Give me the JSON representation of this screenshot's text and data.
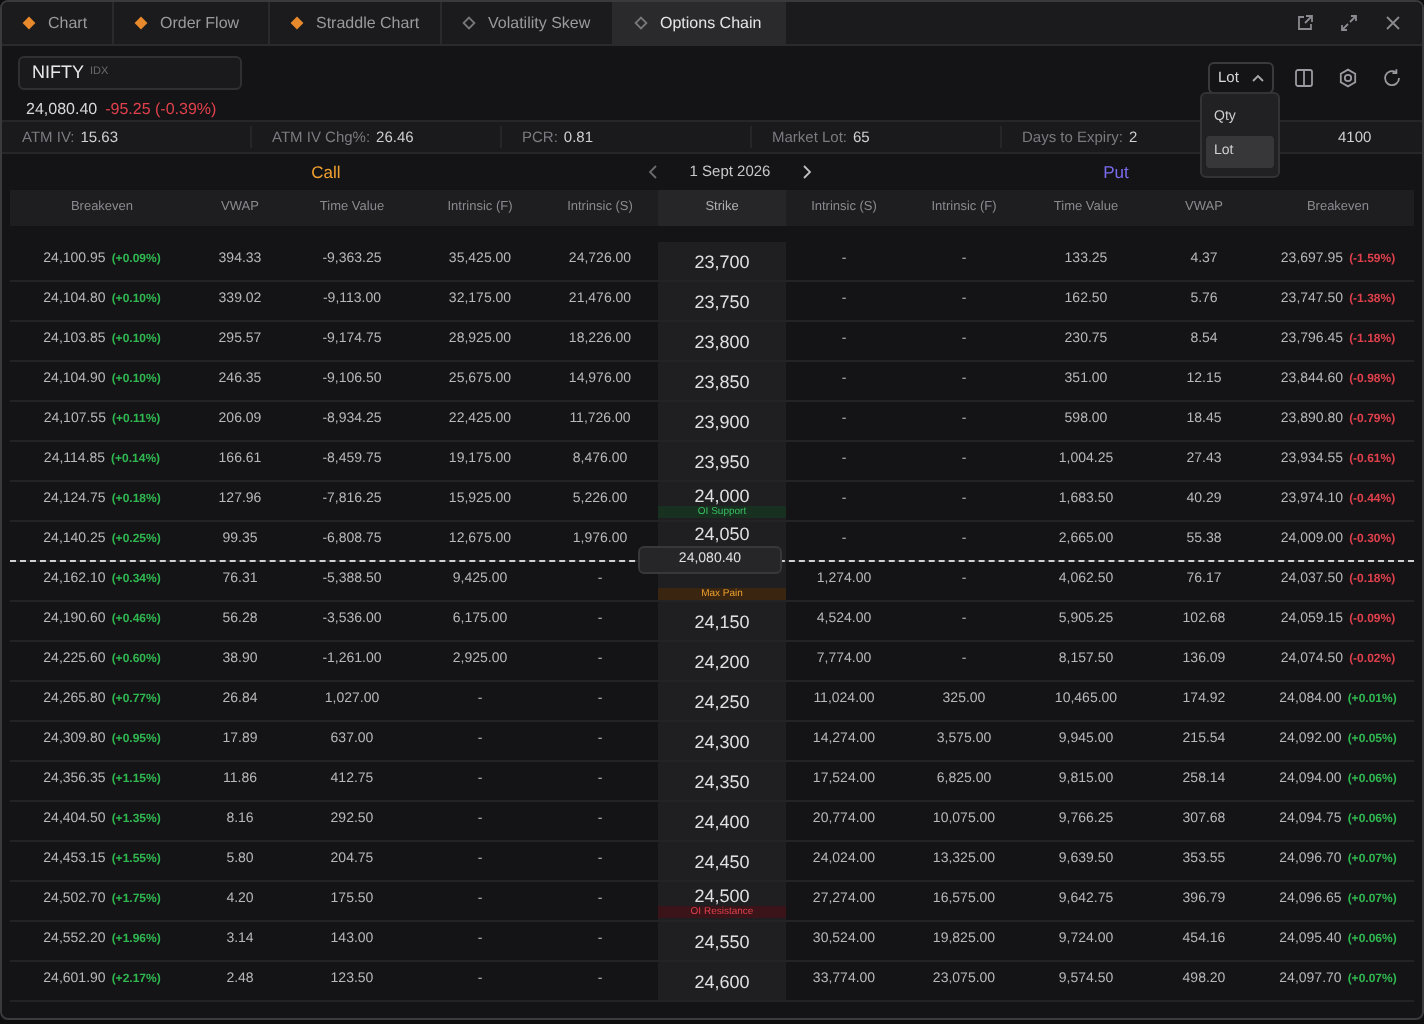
{
  "tabs": [
    {
      "label": "Chart",
      "kind": "filled",
      "selected": false
    },
    {
      "label": "Order Flow",
      "kind": "filled",
      "selected": false
    },
    {
      "label": "Straddle Chart",
      "kind": "filled",
      "selected": false
    },
    {
      "label": "Volatility Skew",
      "kind": "outline",
      "selected": false
    },
    {
      "label": "Options Chain",
      "kind": "outline",
      "selected": true
    }
  ],
  "symbol": {
    "name": "NIFTY",
    "exchange": "IDX",
    "price": "24,080.40",
    "change": "-95.25 (-0.39%)",
    "color": "#e0404c"
  },
  "unit_select": {
    "value": "Lot",
    "expanded": true,
    "options": [
      {
        "label": "Qty",
        "selected": false
      },
      {
        "label": "Lot",
        "selected": true
      }
    ]
  },
  "stats": [
    {
      "label": "ATM IV:",
      "value": "15.63"
    },
    {
      "label": "ATM IV Chg%:",
      "value": "26.46"
    },
    {
      "label": "PCR:",
      "value": "0.81"
    },
    {
      "label": "Market Lot:",
      "value": "65"
    },
    {
      "label": "Days to Expiry:",
      "value": "2"
    },
    {
      "value": "4100"
    }
  ],
  "chain_header": {
    "call_label": "Call",
    "expiry": "1 Sept 2026",
    "put_label": "Put"
  },
  "columns": [
    "Breakeven",
    "VWAP",
    "Time Value",
    "Intrinsic (F)",
    "Intrinsic (S)",
    "Strike",
    "Intrinsic (S)",
    "Intrinsic (F)",
    "Time Value",
    "VWAP",
    "Breakeven"
  ],
  "rows": [
    {
      "kind": "strike",
      "call": {
        "breakeven": "24,100.95",
        "change": "(+0.09%)",
        "color": "#30b850",
        "vwap": "394.33",
        "time_value": "-9,363.25",
        "intrinsic_f": "35,425.00",
        "intrinsic_s": "24,726.00"
      },
      "strike": "23,700",
      "put": {
        "intrinsic_s": "-",
        "intrinsic_f": "-",
        "time_value": "133.25",
        "vwap": "4.37",
        "breakeven": "23,697.95",
        "change": "(-1.59%)",
        "color": "#e0404c"
      }
    },
    {
      "kind": "strike",
      "call": {
        "breakeven": "24,104.80",
        "change": "(+0.10%)",
        "color": "#30b850",
        "vwap": "339.02",
        "time_value": "-9,113.00",
        "intrinsic_f": "32,175.00",
        "intrinsic_s": "21,476.00"
      },
      "strike": "23,750",
      "put": {
        "intrinsic_s": "-",
        "intrinsic_f": "-",
        "time_value": "162.50",
        "vwap": "5.76",
        "breakeven": "23,747.50",
        "change": "(-1.38%)",
        "color": "#e0404c"
      }
    },
    {
      "kind": "strike",
      "call": {
        "breakeven": "24,103.85",
        "change": "(+0.10%)",
        "color": "#30b850",
        "vwap": "295.57",
        "time_value": "-9,174.75",
        "intrinsic_f": "28,925.00",
        "intrinsic_s": "18,226.00"
      },
      "strike": "23,800",
      "put": {
        "intrinsic_s": "-",
        "intrinsic_f": "-",
        "time_value": "230.75",
        "vwap": "8.54",
        "breakeven": "23,796.45",
        "change": "(-1.18%)",
        "color": "#e0404c"
      }
    },
    {
      "kind": "strike",
      "call": {
        "breakeven": "24,104.90",
        "change": "(+0.10%)",
        "color": "#30b850",
        "vwap": "246.35",
        "time_value": "-9,106.50",
        "intrinsic_f": "25,675.00",
        "intrinsic_s": "14,976.00"
      },
      "strike": "23,850",
      "put": {
        "intrinsic_s": "-",
        "intrinsic_f": "-",
        "time_value": "351.00",
        "vwap": "12.15",
        "breakeven": "23,844.60",
        "change": "(-0.98%)",
        "color": "#e0404c"
      }
    },
    {
      "kind": "strike",
      "call": {
        "breakeven": "24,107.55",
        "change": "(+0.11%)",
        "color": "#30b850",
        "vwap": "206.09",
        "time_value": "-8,934.25",
        "intrinsic_f": "22,425.00",
        "intrinsic_s": "11,726.00"
      },
      "strike": "23,900",
      "put": {
        "intrinsic_s": "-",
        "intrinsic_f": "-",
        "time_value": "598.00",
        "vwap": "18.45",
        "breakeven": "23,890.80",
        "change": "(-0.79%)",
        "color": "#e0404c"
      }
    },
    {
      "kind": "strike",
      "call": {
        "breakeven": "24,114.85",
        "change": "(+0.14%)",
        "color": "#30b850",
        "vwap": "166.61",
        "time_value": "-8,459.75",
        "intrinsic_f": "19,175.00",
        "intrinsic_s": "8,476.00"
      },
      "strike": "23,950",
      "put": {
        "intrinsic_s": "-",
        "intrinsic_f": "-",
        "time_value": "1,004.25",
        "vwap": "27.43",
        "breakeven": "23,934.55",
        "change": "(-0.61%)",
        "color": "#e0404c"
      }
    },
    {
      "kind": "strike",
      "call": {
        "breakeven": "24,124.75",
        "change": "(+0.18%)",
        "color": "#30b850",
        "vwap": "127.96",
        "time_value": "-7,816.25",
        "intrinsic_f": "15,925.00",
        "intrinsic_s": "5,226.00"
      },
      "strike": "24,000",
      "tag": {
        "text": "OI Support",
        "kind": "support"
      },
      "put": {
        "intrinsic_s": "-",
        "intrinsic_f": "-",
        "time_value": "1,683.50",
        "vwap": "40.29",
        "breakeven": "23,974.10",
        "change": "(-0.44%)",
        "color": "#e0404c"
      }
    },
    {
      "kind": "strike",
      "call": {
        "breakeven": "24,140.25",
        "change": "(+0.25%)",
        "color": "#30b850",
        "vwap": "99.35",
        "time_value": "-6,808.75",
        "intrinsic_f": "12,675.00",
        "intrinsic_s": "1,976.00"
      },
      "strike": "24,050",
      "put": {
        "intrinsic_s": "-",
        "intrinsic_f": "-",
        "time_value": "2,665.00",
        "vwap": "55.38",
        "breakeven": "24,009.00",
        "change": "(-0.30%)",
        "color": "#e0404c"
      }
    },
    {
      "kind": "spot",
      "price": "24,080.40"
    },
    {
      "kind": "strike",
      "call": {
        "breakeven": "24,162.10",
        "change": "(+0.34%)",
        "color": "#30b850",
        "vwap": "76.31",
        "time_value": "-5,388.50",
        "intrinsic_f": "9,425.00",
        "intrinsic_s": "-"
      },
      "tag": {
        "text": "Max Pain",
        "kind": "max-pain"
      },
      "put": {
        "intrinsic_s": "1,274.00",
        "intrinsic_f": "-",
        "time_value": "4,062.50",
        "vwap": "76.17",
        "breakeven": "24,037.50",
        "change": "(-0.18%)",
        "color": "#e0404c"
      }
    },
    {
      "kind": "strike",
      "call": {
        "breakeven": "24,190.60",
        "change": "(+0.46%)",
        "color": "#30b850",
        "vwap": "56.28",
        "time_value": "-3,536.00",
        "intrinsic_f": "6,175.00",
        "intrinsic_s": "-"
      },
      "strike": "24,150",
      "put": {
        "intrinsic_s": "4,524.00",
        "intrinsic_f": "-",
        "time_value": "5,905.25",
        "vwap": "102.68",
        "breakeven": "24,059.15",
        "change": "(-0.09%)",
        "color": "#e0404c"
      }
    },
    {
      "kind": "strike",
      "call": {
        "breakeven": "24,225.60",
        "change": "(+0.60%)",
        "color": "#30b850",
        "vwap": "38.90",
        "time_value": "-1,261.00",
        "intrinsic_f": "2,925.00",
        "intrinsic_s": "-"
      },
      "strike": "24,200",
      "put": {
        "intrinsic_s": "7,774.00",
        "intrinsic_f": "-",
        "time_value": "8,157.50",
        "vwap": "136.09",
        "breakeven": "24,074.50",
        "change": "(-0.02%)",
        "color": "#e0404c"
      }
    },
    {
      "kind": "strike",
      "call": {
        "breakeven": "24,265.80",
        "change": "(+0.77%)",
        "color": "#30b850",
        "vwap": "26.84",
        "time_value": "1,027.00",
        "intrinsic_f": "-",
        "intrinsic_s": "-"
      },
      "strike": "24,250",
      "put": {
        "intrinsic_s": "11,024.00",
        "intrinsic_f": "325.00",
        "time_value": "10,465.00",
        "vwap": "174.92",
        "breakeven": "24,084.00",
        "change": "(+0.01%)",
        "color": "#30b850"
      }
    },
    {
      "kind": "strike",
      "call": {
        "breakeven": "24,309.80",
        "change": "(+0.95%)",
        "color": "#30b850",
        "vwap": "17.89",
        "time_value": "637.00",
        "intrinsic_f": "-",
        "intrinsic_s": "-"
      },
      "strike": "24,300",
      "put": {
        "intrinsic_s": "14,274.00",
        "intrinsic_f": "3,575.00",
        "time_value": "9,945.00",
        "vwap": "215.54",
        "breakeven": "24,092.00",
        "change": "(+0.05%)",
        "color": "#30b850"
      }
    },
    {
      "kind": "strike",
      "call": {
        "breakeven": "24,356.35",
        "change": "(+1.15%)",
        "color": "#30b850",
        "vwap": "11.86",
        "time_value": "412.75",
        "intrinsic_f": "-",
        "intrinsic_s": "-"
      },
      "strike": "24,350",
      "put": {
        "intrinsic_s": "17,524.00",
        "intrinsic_f": "6,825.00",
        "time_value": "9,815.00",
        "vwap": "258.14",
        "breakeven": "24,094.00",
        "change": "(+0.06%)",
        "color": "#30b850"
      }
    },
    {
      "kind": "strike",
      "call": {
        "breakeven": "24,404.50",
        "change": "(+1.35%)",
        "color": "#30b850",
        "vwap": "8.16",
        "time_value": "292.50",
        "intrinsic_f": "-",
        "intrinsic_s": "-"
      },
      "strike": "24,400",
      "put": {
        "intrinsic_s": "20,774.00",
        "intrinsic_f": "10,075.00",
        "time_value": "9,766.25",
        "vwap": "307.68",
        "breakeven": "24,094.75",
        "change": "(+0.06%)",
        "color": "#30b850"
      }
    },
    {
      "kind": "strike",
      "call": {
        "breakeven": "24,453.15",
        "change": "(+1.55%)",
        "color": "#30b850",
        "vwap": "5.80",
        "time_value": "204.75",
        "intrinsic_f": "-",
        "intrinsic_s": "-"
      },
      "strike": "24,450",
      "put": {
        "intrinsic_s": "24,024.00",
        "intrinsic_f": "13,325.00",
        "time_value": "9,639.50",
        "vwap": "353.55",
        "breakeven": "24,096.70",
        "change": "(+0.07%)",
        "color": "#30b850"
      }
    },
    {
      "kind": "strike",
      "call": {
        "breakeven": "24,502.70",
        "change": "(+1.75%)",
        "color": "#30b850",
        "vwap": "4.20",
        "time_value": "175.50",
        "intrinsic_f": "-",
        "intrinsic_s": "-"
      },
      "strike": "24,500",
      "tag": {
        "text": "OI Resistance",
        "kind": "resistance"
      },
      "put": {
        "intrinsic_s": "27,274.00",
        "intrinsic_f": "16,575.00",
        "time_value": "9,642.75",
        "vwap": "396.79",
        "breakeven": "24,096.65",
        "change": "(+0.07%)",
        "color": "#30b850"
      }
    },
    {
      "kind": "strike",
      "call": {
        "breakeven": "24,552.20",
        "change": "(+1.96%)",
        "color": "#30b850",
        "vwap": "3.14",
        "time_value": "143.00",
        "intrinsic_f": "-",
        "intrinsic_s": "-"
      },
      "strike": "24,550",
      "put": {
        "intrinsic_s": "30,524.00",
        "intrinsic_f": "19,825.00",
        "time_value": "9,724.00",
        "vwap": "454.16",
        "breakeven": "24,095.40",
        "change": "(+0.06%)",
        "color": "#30b850"
      }
    },
    {
      "kind": "strike",
      "call": {
        "breakeven": "24,601.90",
        "change": "(+2.17%)",
        "color": "#30b850",
        "vwap": "2.48",
        "time_value": "123.50",
        "intrinsic_f": "-",
        "intrinsic_s": "-"
      },
      "strike": "24,600",
      "put": {
        "intrinsic_s": "33,774.00",
        "intrinsic_f": "23,075.00",
        "time_value": "9,574.50",
        "vwap": "498.20",
        "breakeven": "24,097.70",
        "change": "(+0.07%)",
        "color": "#30b850"
      }
    }
  ]
}
